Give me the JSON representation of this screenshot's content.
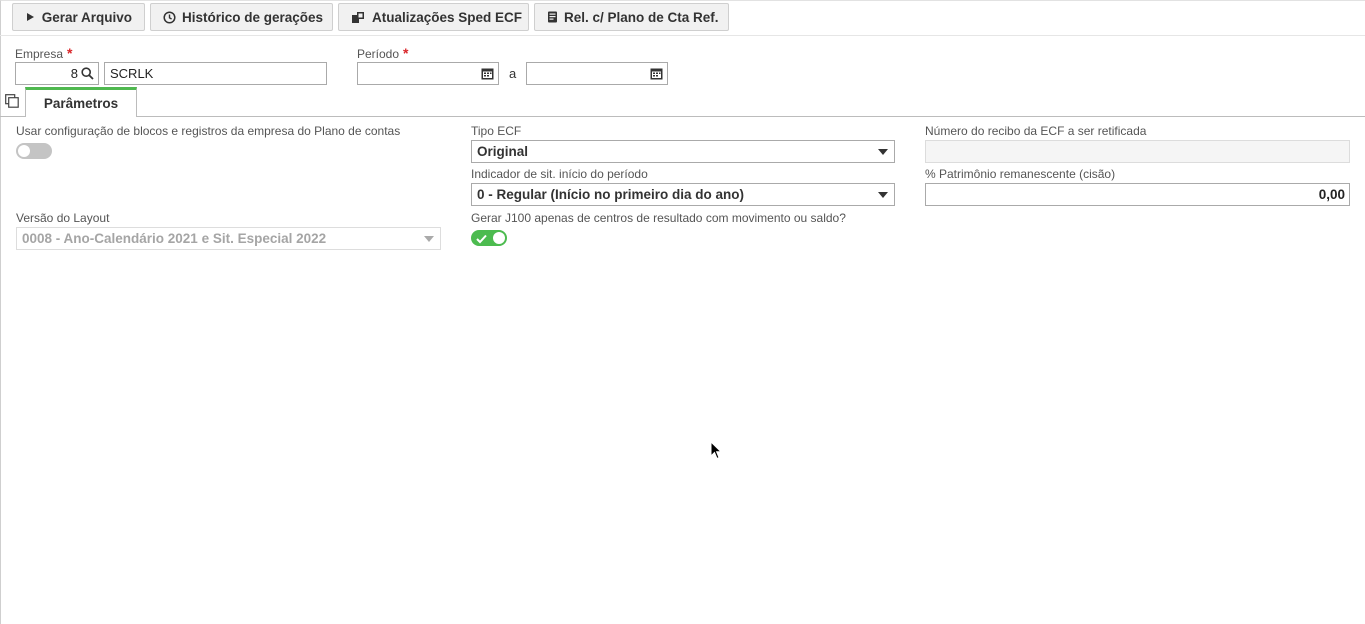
{
  "toolbar": {
    "buttons": [
      {
        "label": "Gerar Arquivo",
        "icon": "play-icon"
      },
      {
        "label": "Histórico de gerações",
        "icon": "clock-icon"
      },
      {
        "label": "Atualizações Sped ECF",
        "icon": "refresh-docs-icon"
      },
      {
        "label": "Rel. c/ Plano de Cta Ref.",
        "icon": "document-icon"
      }
    ]
  },
  "header": {
    "empresa": {
      "label": "Empresa",
      "required_mark": "*",
      "code": "8",
      "name": "SCRLK"
    },
    "periodo": {
      "label": "Período",
      "required_mark": "*",
      "start": "",
      "end": "",
      "separator": "a"
    }
  },
  "tabs": [
    {
      "label": "Parâmetros",
      "active": true
    }
  ],
  "params": {
    "usar_config": {
      "label": "Usar configuração de blocos e registros da empresa do Plano de contas",
      "value": false
    },
    "tipo_ecf": {
      "label": "Tipo ECF",
      "value": "Original"
    },
    "numero_recibo": {
      "label": "Número do recibo da ECF a ser retificada",
      "value": ""
    },
    "indicador": {
      "label": "Indicador de sit. início do período",
      "value": "0 - Regular (Início no primeiro dia do ano)"
    },
    "patrimonio": {
      "label": "% Patrimônio remanescente (cisão)",
      "value": "0,00"
    },
    "versao_layout": {
      "label": "Versão do Layout",
      "value": "0008 - Ano-Calendário 2021 e Sit. Especial 2022",
      "disabled": true
    },
    "gerar_j100": {
      "label": "Gerar J100 apenas de centros de resultado com movimento ou saldo?",
      "value": true
    }
  },
  "colors": {
    "accent_green": "#4cbb4f",
    "required_red": "#d9262a"
  }
}
